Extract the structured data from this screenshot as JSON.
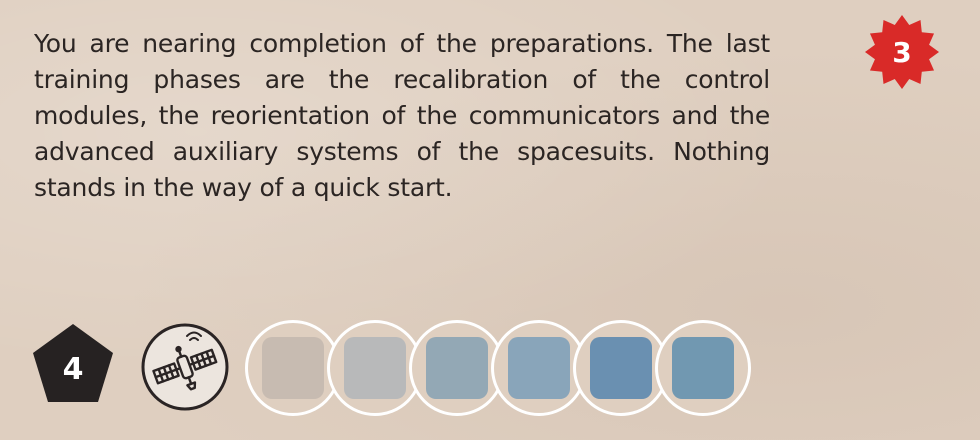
{
  "card": {
    "text": "You are nearing completion of the preparations. The last training phases are the recalibration of the control modules, the reorientation of the communicators and the advanced auxiliary systems of the spacesuits. Nothing stands in the way of a quick start."
  },
  "badges": {
    "star_number": "3",
    "star_color": "#d92a28",
    "pentagon_number": "4",
    "pentagon_color": "#262222"
  },
  "icons": {
    "satellite": "satellite-icon"
  },
  "tokens": [
    {
      "color": "#c7bbb1"
    },
    {
      "color": "#b8b9ba"
    },
    {
      "color": "#93a8b5"
    },
    {
      "color": "#89a5ba"
    },
    {
      "color": "#6a90b1"
    },
    {
      "color": "#7198b1"
    }
  ]
}
